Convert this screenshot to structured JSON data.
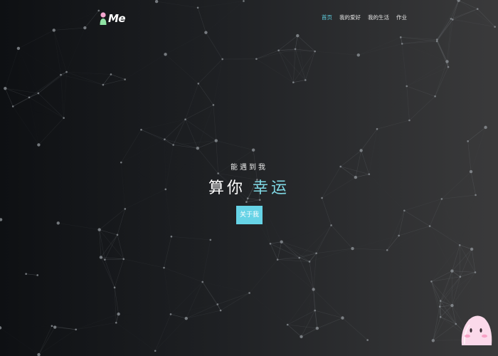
{
  "header": {
    "logo_text": "Me",
    "nav": [
      {
        "label": "首页",
        "active": true
      },
      {
        "label": "我的爱好",
        "active": false
      },
      {
        "label": "我的生活",
        "active": false
      },
      {
        "label": "作业",
        "active": false
      }
    ]
  },
  "hero": {
    "subtitle": "能遇到我",
    "title_prefix": "算你",
    "title_accent": "幸运",
    "button_label": "关于我"
  },
  "colors": {
    "accent": "#66d3e6",
    "accent_text": "#7fd8e4",
    "background": "#1c1d20"
  },
  "icons": {
    "logo": "person-logo-icon",
    "mascot": "pink-blob-mascot-icon"
  }
}
